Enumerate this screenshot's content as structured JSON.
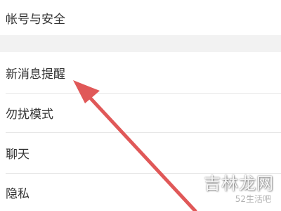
{
  "settings": {
    "items": [
      {
        "label": "帐号与安全"
      },
      {
        "label": "新消息提醒"
      },
      {
        "label": "勿扰模式"
      },
      {
        "label": "聊天"
      },
      {
        "label": "隐私"
      }
    ]
  },
  "annotation": {
    "arrow_color": "#e05858",
    "arrow_points_to": "新消息提醒"
  },
  "watermark": {
    "main": "吉林龙网",
    "sub": "52生活吧"
  }
}
